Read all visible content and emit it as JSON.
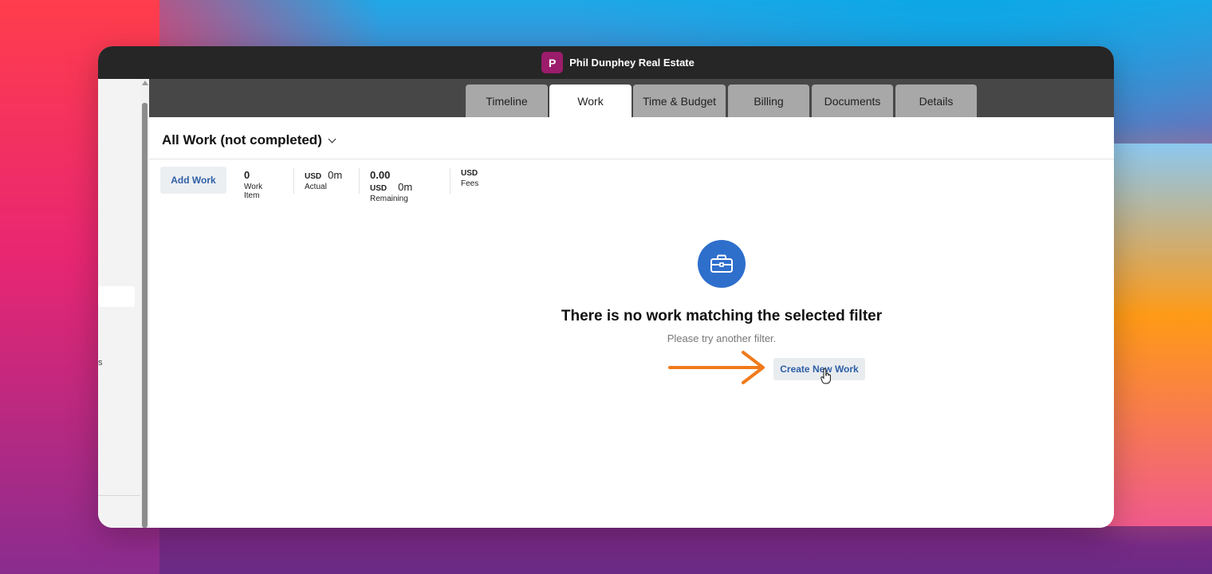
{
  "window": {
    "client_initial": "P",
    "client_name": "Phil Dunphey Real Estate"
  },
  "tabs": [
    {
      "label": "Timeline",
      "active": false
    },
    {
      "label": "Work",
      "active": true
    },
    {
      "label": "Time & Budget",
      "active": false
    },
    {
      "label": "Billing",
      "active": false
    },
    {
      "label": "Documents",
      "active": false
    },
    {
      "label": "Details",
      "active": false
    }
  ],
  "view": {
    "filter_title": "All Work (not completed)"
  },
  "summary": {
    "add_work_label": "Add Work",
    "work_item_count": "0",
    "work_item_label": "Work Item",
    "actual_currency": "USD",
    "actual_minutes": "0m",
    "actual_label": "Actual",
    "remaining_amount": "0.00",
    "remaining_currency": "USD",
    "remaining_minutes": "0m",
    "remaining_label": "Remaining",
    "fees_currency": "USD",
    "fees_label": "Fees"
  },
  "empty_state": {
    "icon": "briefcase-icon",
    "title": "There is no work matching the selected filter",
    "subtitle": "Please try another filter.",
    "create_label": "Create New Work"
  },
  "left_panel": {
    "partial_text": "s"
  },
  "colors": {
    "accent_blue": "#2e6fcc",
    "link_blue": "#2e5fa6",
    "avatar": "#9b1c6b",
    "annotation_arrow": "#f07a1a"
  }
}
